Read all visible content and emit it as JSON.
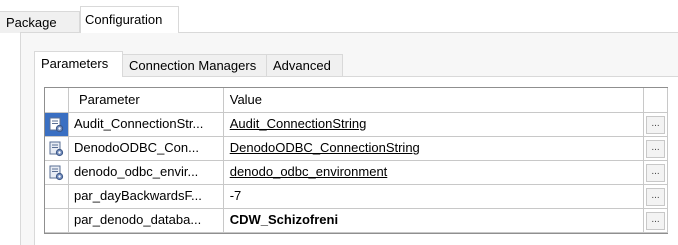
{
  "outer_tabs": {
    "package": "Package",
    "configuration": "Configuration"
  },
  "inner_tabs": {
    "parameters": "Parameters",
    "connection_managers": "Connection Managers",
    "advanced": "Advanced"
  },
  "grid": {
    "headers": {
      "parameter": "Parameter",
      "value": "Value"
    },
    "rows": [
      {
        "parameter": "Audit_ConnectionStr...",
        "value": "Audit_ConnectionString",
        "button": "...",
        "icon": "connection-parameter-icon",
        "style": "link",
        "selected": true
      },
      {
        "parameter": "DenodoODBC_Con...",
        "value": "DenodoODBC_ConnectionString",
        "button": "...",
        "icon": "connection-parameter-icon",
        "style": "link",
        "selected": false
      },
      {
        "parameter": "denodo_odbc_envir...",
        "value": "denodo_odbc_environment",
        "button": "...",
        "icon": "connection-parameter-icon",
        "style": "link",
        "selected": false
      },
      {
        "parameter": "par_dayBackwardsF...",
        "value": "-7",
        "button": "...",
        "icon": "",
        "style": "plain",
        "selected": false
      },
      {
        "parameter": "par_denodo_databa...",
        "value": "CDW_Schizofreni",
        "button": "...",
        "icon": "",
        "style": "bold",
        "selected": false
      }
    ]
  },
  "colors": {
    "selection": "#3a6fc2",
    "border": "#c8c8c8",
    "panel": "#f7f7f7"
  }
}
